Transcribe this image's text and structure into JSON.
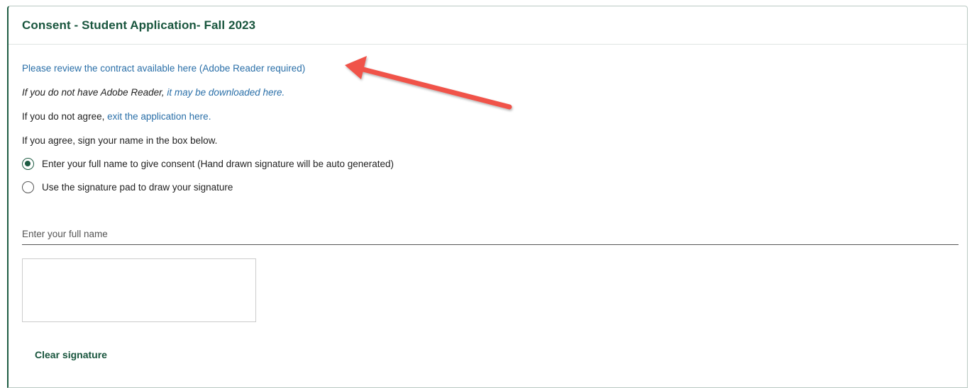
{
  "panel": {
    "title": "Consent - Student Application- Fall 2023"
  },
  "content": {
    "review_link": "Please review the contract available here (Adobe Reader required)",
    "adobe_prefix": "If you do not have Adobe Reader, ",
    "adobe_link": "it may be downloaded here.",
    "disagree_prefix": "If you do not agree, ",
    "disagree_link": "exit the application here.",
    "agree_text": "If you agree, sign your name in the box below."
  },
  "options": [
    {
      "label": "Enter your full name to give consent (Hand drawn signature will be auto generated)",
      "checked": true
    },
    {
      "label": "Use the signature pad to draw your signature",
      "checked": false
    }
  ],
  "name_field": {
    "placeholder": "Enter your full name",
    "value": ""
  },
  "signature": {
    "clear_label": "Clear signature"
  },
  "annotation": {
    "arrow_color": "#f0524a"
  },
  "colors": {
    "brand_green": "#18553d",
    "link_blue": "#2a6fa8"
  }
}
